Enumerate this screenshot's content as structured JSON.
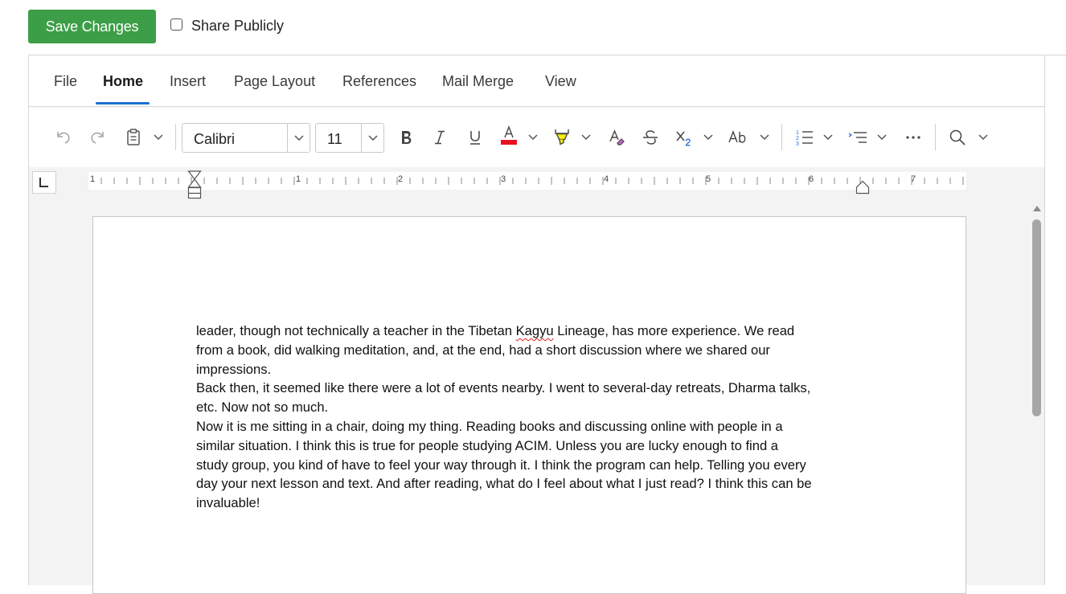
{
  "topbar": {
    "save_label": "Save Changes",
    "share_label": "Share Publicly",
    "share_checked": false
  },
  "tabs": [
    {
      "label": "File",
      "active": false
    },
    {
      "label": "Home",
      "active": true
    },
    {
      "label": "Insert",
      "active": false
    },
    {
      "label": "Page Layout",
      "active": false
    },
    {
      "label": "References",
      "active": false
    },
    {
      "label": "Mail Merge",
      "active": false
    },
    {
      "label": "View",
      "active": false
    }
  ],
  "toolbar": {
    "font_name": "Calibri",
    "font_size": "11",
    "font_color": "#e81123",
    "highlight_color": "#fff200",
    "icons": [
      "undo-icon",
      "redo-icon",
      "clipboard-icon",
      "bold-icon",
      "italic-icon",
      "underline-icon",
      "font-color-icon",
      "highlight-icon",
      "clear-format-icon",
      "strikethrough-icon",
      "subscript-icon",
      "change-case-icon",
      "numbered-list-icon",
      "bullet-list-icon",
      "more-icon",
      "find-icon"
    ]
  },
  "ruler": {
    "numbers": [
      "1",
      "1",
      "2",
      "3",
      "4",
      "5",
      "6",
      "7"
    ]
  },
  "document": {
    "lines": [
      [
        "leader, though not technically a teacher in the Tibetan ",
        {
          "squiggle": "Kagyu"
        },
        " Lineage, has more experience. We read"
      ],
      [
        "from a book, did walking meditation, and, at the end, had a short discussion where we shared our"
      ],
      [
        "impressions."
      ],
      [
        "Back then, it seemed like there were a lot of events nearby. I went to several-day retreats, Dharma talks,"
      ],
      [
        "etc. Now not so much."
      ],
      [
        "Now it is me sitting in a chair, doing my thing. Reading books and discussing online with people in a"
      ],
      [
        "similar situation. I think this is true for people studying ACIM. Unless you are lucky enough to find a"
      ],
      [
        "study group, you kind of have to feel your way through it. I think the program can help. Telling you every"
      ],
      [
        "day your next lesson and text. And after reading, what do I feel about what I just read? I think this can be"
      ],
      [
        "invaluable!"
      ]
    ]
  },
  "colors": {
    "save_button": "#3c9e46",
    "active_tab_underline": "#1d6fd1",
    "spell_error": "#e02020"
  }
}
